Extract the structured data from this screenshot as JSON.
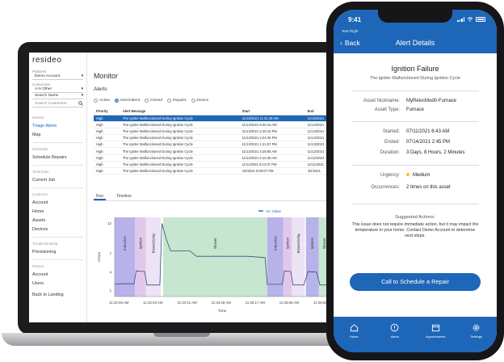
{
  "colors": {
    "accent": "#1e66b8",
    "selected_row": "#1e66b8",
    "urgency_medium": "#f2c230"
  },
  "laptop": {
    "logo": "resideo",
    "sidebar": {
      "partners_label": "Partners",
      "partners_value": "Demo Account",
      "customers_label": "Customers",
      "customers_value": "A N Other",
      "search_scope": "Search Name",
      "search_placeholder": "Search Customers",
      "section_monitor": "Monitor",
      "item_triage": "Triage Alerts",
      "item_map": "Map",
      "section_scheduler": "Scheduler",
      "item_schedule": "Schedule Repairs",
      "section_technician": "Technician",
      "item_current_job": "Current Job",
      "section_customer": "Customer",
      "item_account": "Account",
      "item_home": "Home",
      "item_assets": "Assets",
      "item_devices": "Devices",
      "section_troubleshooting": "Troubleshooting",
      "item_provisioning": "Provisioning",
      "section_partner": "Partner",
      "item_partner_account": "Account",
      "item_users": "Users",
      "item_back": "Back to Landing"
    },
    "main": {
      "title": "Monitor",
      "alerts_title": "Alerts",
      "filters": [
        "Active",
        "Intermittent",
        "Closed",
        "Repairs",
        "Device"
      ],
      "selected_filter": 1,
      "columns": [
        "Priority",
        "Alert Message",
        "Start",
        "End"
      ],
      "rows": [
        [
          "High",
          "The Igniter Malfunctioned During Ignition Cycle",
          "11/15/2021 11:31:49 AM",
          "11/15/2021"
        ],
        [
          "High",
          "The Igniter Malfunctioned During Ignition Cycle",
          "11/14/2021 8:30:16 AM",
          "11/14/2021"
        ],
        [
          "High",
          "The Igniter Malfunctioned During Ignition Cycle",
          "11/13/2021 2:45:16 PM",
          "11/13/2021"
        ],
        [
          "High",
          "The Igniter Malfunctioned During Ignition Cycle",
          "11/13/2021 2:24:36 PM",
          "11/13/2021"
        ],
        [
          "High",
          "The Igniter Malfunctioned During Ignition Cycle",
          "11/13/2021 1:21:57 PM",
          "11/13/2021"
        ],
        [
          "High",
          "The Igniter Malfunctioned During Ignition Cycle",
          "11/12/2021 4:28:55 AM",
          "11/12/2021"
        ],
        [
          "High",
          "The Igniter Malfunctioned During Ignition Cycle",
          "11/12/2021 2:12:48 AM",
          "11/12/2021"
        ],
        [
          "High",
          "The Igniter Malfunctioned During Ignition Cycle",
          "11/11/2021 8:12:07 PM",
          "11/11/2021"
        ],
        [
          "High",
          "The Igniter Malfunctioned During Ignition Cycle",
          "4/2/2021 8:03:07 PM",
          "4/2/2021"
        ]
      ],
      "tabs": [
        "Run",
        "Timeline"
      ],
      "selected_tab": 0
    },
    "chart_data": {
      "type": "line",
      "legend": "AC Value",
      "ylabel": "Amps",
      "xlabel": "Time",
      "y_ticks": [
        1,
        4,
        7,
        12
      ],
      "ylim": [
        0,
        13
      ],
      "x_ticks": [
        "11:32:05 AM",
        "11:32:53 AM",
        "11:33:41 AM",
        "11:34:29 AM",
        "11:35:17 AM",
        "11:36:05 AM",
        "11:36:53 AM"
      ],
      "phases": [
        {
          "label": "Induction",
          "start": 0.0,
          "end": 0.095,
          "color": "#b7b3ea"
        },
        {
          "label": "Ignition",
          "start": 0.095,
          "end": 0.145,
          "color": "#e1c8ea"
        },
        {
          "label": "BlowerDelay",
          "start": 0.145,
          "end": 0.215,
          "color": "#ece4f5"
        },
        {
          "label": "Blower",
          "start": 0.225,
          "end": 0.71,
          "color": "#c6e6cf"
        },
        {
          "label": "Induction",
          "start": 0.71,
          "end": 0.785,
          "color": "#b7b3ea"
        },
        {
          "label": "Ignition",
          "start": 0.785,
          "end": 0.825,
          "color": "#e1c8ea"
        },
        {
          "label": "BlowerDelay",
          "start": 0.825,
          "end": 0.885,
          "color": "#ece4f5"
        },
        {
          "label": "Ignition",
          "start": 0.89,
          "end": 0.95,
          "color": "#b7b3ea"
        },
        {
          "label": "Blower",
          "start": 0.95,
          "end": 1.0,
          "color": "#c6e6cf"
        }
      ],
      "series": [
        {
          "name": "AC Value",
          "points": [
            [
              0.0,
              2.0
            ],
            [
              0.02,
              2.1
            ],
            [
              0.09,
              2.1
            ],
            [
              0.1,
              4.2
            ],
            [
              0.14,
              4.1
            ],
            [
              0.15,
              1.9
            ],
            [
              0.21,
              1.9
            ],
            [
              0.22,
              12.0
            ],
            [
              0.24,
              9.5
            ],
            [
              0.26,
              7.5
            ],
            [
              0.35,
              7.5
            ],
            [
              0.38,
              6.6
            ],
            [
              0.62,
              6.6
            ],
            [
              0.7,
              6.4
            ],
            [
              0.71,
              2.0
            ],
            [
              0.78,
              2.0
            ],
            [
              0.79,
              4.2
            ],
            [
              0.82,
              4.1
            ],
            [
              0.83,
              1.9
            ],
            [
              0.88,
              1.9
            ],
            [
              0.9,
              4.1
            ],
            [
              0.94,
              4.0
            ],
            [
              0.955,
              1.9
            ],
            [
              1.0,
              1.9
            ]
          ]
        }
      ]
    }
  },
  "phone": {
    "status_time": "9:41",
    "crumb": "Test Flight",
    "back_label": "Back",
    "nav_title": "Alert Details",
    "title": "Ignition Failure",
    "subtitle": "The Igniter Malfunctioned During Ignition Cycle",
    "asset_nickname_label": "Asset Nickname:",
    "asset_nickname": "MyReivcMod0-Furnace",
    "asset_type_label": "Asset Type:",
    "asset_type": "Furnace",
    "started_label": "Started:",
    "started": "07/11/2021 6:43 AM",
    "ended_label": "Ended:",
    "ended": "07/14/2021 2:45 PM",
    "duration_label": "Duration:",
    "duration": "3 Days, 8 Hours, 2 Minutes",
    "urgency_label": "Urgency:",
    "urgency": "Medium",
    "occurrences_label": "Occurrences:",
    "occurrences": "2 times on this asset",
    "suggested_title": "Suggested Actions:",
    "suggested_body": "This issue does not require immediate action, but it may impact the temperature in your home. Contact Demo Account to determine next steps.",
    "cta": "Call to Schedule a Repair",
    "tabbar": [
      "Home",
      "Alerts",
      "Appointments",
      "Settings"
    ]
  }
}
